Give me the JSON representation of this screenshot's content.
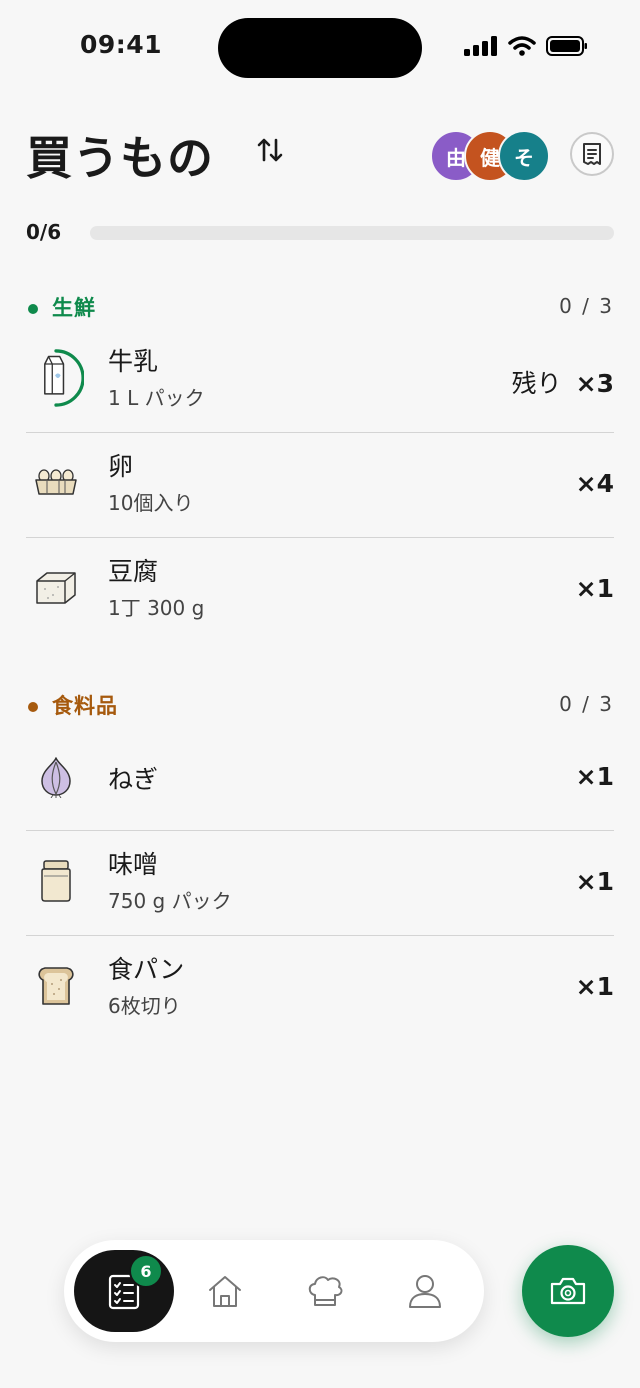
{
  "status_bar": {
    "time": "09:41"
  },
  "header": {
    "title": "買うもの",
    "members": [
      {
        "initial": "由",
        "color": "#8a5cc7"
      },
      {
        "initial": "健",
        "color": "#c4531f"
      },
      {
        "initial": "そ",
        "color": "#16808a"
      }
    ]
  },
  "progress": {
    "label": "0/6",
    "fraction": 0
  },
  "sections": [
    {
      "title": "生鮮",
      "count": "0 / 3",
      "color": "#0f8a4c",
      "items": [
        {
          "name": "牛乳",
          "detail": "1 L パック",
          "remaining_label": "残り",
          "qty": "×3",
          "icon": "milk-carton-icon"
        },
        {
          "name": "卵",
          "detail": "10個入り",
          "qty": "×4",
          "icon": "egg-carton-icon"
        },
        {
          "name": "豆腐",
          "detail": "1丁 300 g",
          "qty": "×1",
          "icon": "tofu-icon"
        }
      ]
    },
    {
      "title": "食料品",
      "count": "0 / 3",
      "color": "#a65a0e",
      "items": [
        {
          "name": "ねぎ",
          "qty": "×1",
          "icon": "onion-icon"
        },
        {
          "name": "味噌",
          "detail": "750 g パック",
          "qty": "×1",
          "icon": "miso-jar-icon"
        },
        {
          "name": "食パン",
          "detail": "6枚切り",
          "qty": "×1",
          "icon": "bread-icon"
        }
      ]
    }
  ],
  "tabbar": {
    "list_badge": "6",
    "tabs": [
      "list-tab",
      "home-tab",
      "recipes-tab",
      "profile-tab"
    ]
  },
  "colors": {
    "accent": "#0f8a4c",
    "background": "#f7f7f7"
  }
}
